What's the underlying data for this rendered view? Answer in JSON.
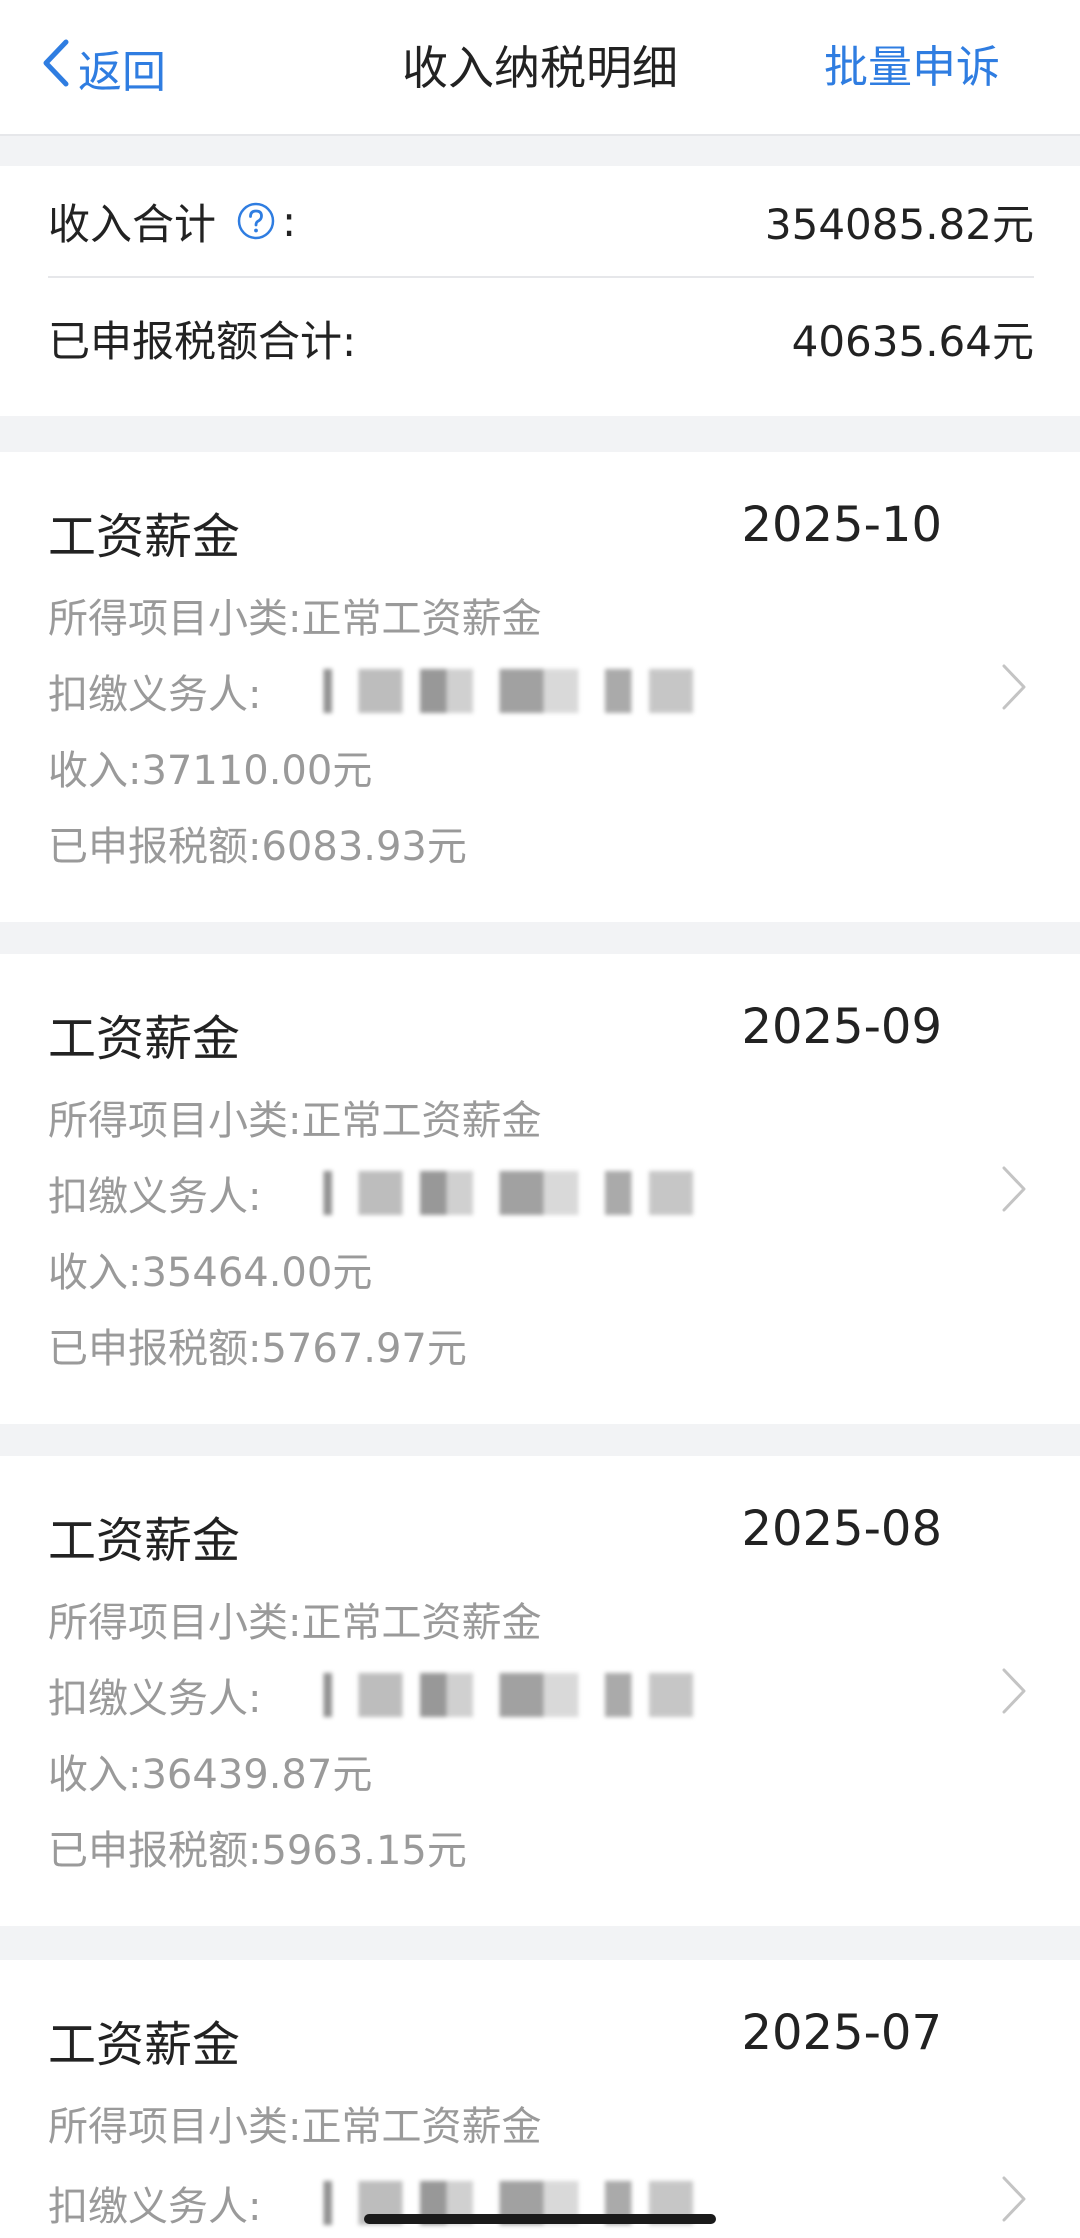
{
  "header": {
    "back_label": "返回",
    "title": "收入纳税明细",
    "appeal_label": "批量申诉"
  },
  "summary": {
    "income_label": "收入合计",
    "income_colon": ":",
    "income_value": "354085.82元",
    "tax_label": "已申报税额合计:",
    "tax_value": "40635.64元"
  },
  "records": [
    {
      "title": "工资薪金",
      "period": "2025-10",
      "subcategory": "所得项目小类:正常工资薪金",
      "withholder_label": "扣缴义务人:",
      "income": "收入:37110.00元",
      "tax": "已申报税额:6083.93元"
    },
    {
      "title": "工资薪金",
      "period": "2025-09",
      "subcategory": "所得项目小类:正常工资薪金",
      "withholder_label": "扣缴义务人:",
      "income": "收入:35464.00元",
      "tax": "已申报税额:5767.97元"
    },
    {
      "title": "工资薪金",
      "period": "2025-08",
      "subcategory": "所得项目小类:正常工资薪金",
      "withholder_label": "扣缴义务人:",
      "income": "收入:36439.87元",
      "tax": "已申报税额:5963.15元"
    },
    {
      "title": "工资薪金",
      "period": "2025-07",
      "subcategory": "所得项目小类:正常工资薪金",
      "withholder_label": "扣缴义务人:"
    }
  ],
  "icons": {
    "back": "chevron-left-icon",
    "help": "question-circle-icon",
    "row": "chevron-right-icon"
  },
  "colors": {
    "accent": "#2f7de1",
    "background": "#f2f3f5",
    "card": "#ffffff",
    "secondary_text": "#9a9a9a"
  }
}
